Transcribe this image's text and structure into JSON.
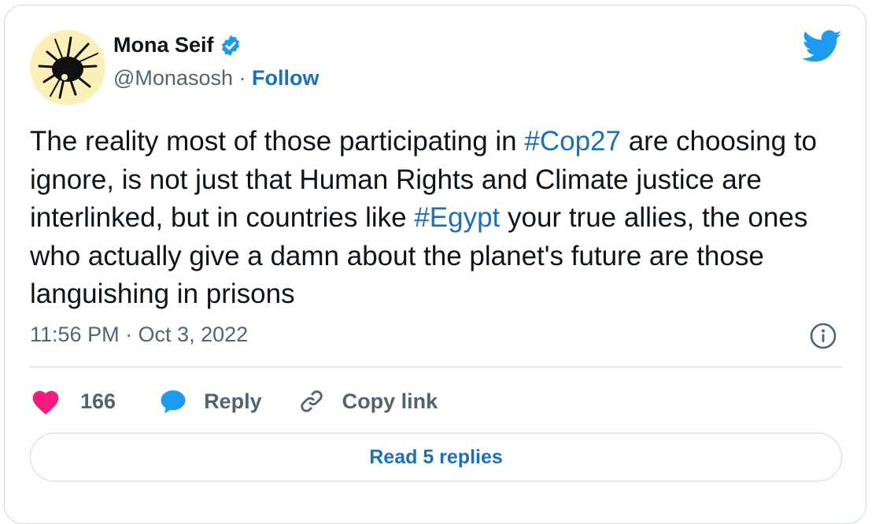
{
  "author": {
    "name": "Mona Seif",
    "handle": "@Monasosh",
    "separator": "·",
    "follow_label": "Follow"
  },
  "tweet": {
    "segments": [
      {
        "text": "The reality most of those participating in ",
        "hashtag": false
      },
      {
        "text": "#Cop27",
        "hashtag": true
      },
      {
        "text": " are choosing to ignore, is not just that Human Rights and Climate justice are interlinked, but in countries like ",
        "hashtag": false
      },
      {
        "text": "#Egypt",
        "hashtag": true
      },
      {
        "text": " your true allies, the ones who actually give a damn about the planet's future are those languishing in prisons",
        "hashtag": false
      }
    ],
    "timestamp": "11:56 PM · Oct 3, 2022"
  },
  "actions": {
    "likes": "166",
    "reply_label": "Reply",
    "copy_link_label": "Copy link"
  },
  "footer": {
    "read_replies_label": "Read 5 replies"
  },
  "icons": {
    "heart": "heart-icon",
    "reply": "speech-bubble-icon",
    "link": "link-icon",
    "info": "info-icon",
    "bird": "twitter-bird-icon",
    "verified": "verified-badge-icon"
  },
  "colors": {
    "text": "#0f1419",
    "secondary": "#536471",
    "link": "#1d70b8",
    "twitter_blue": "#1d9bf0",
    "heart": "#f91880",
    "border": "#cfd9de"
  }
}
